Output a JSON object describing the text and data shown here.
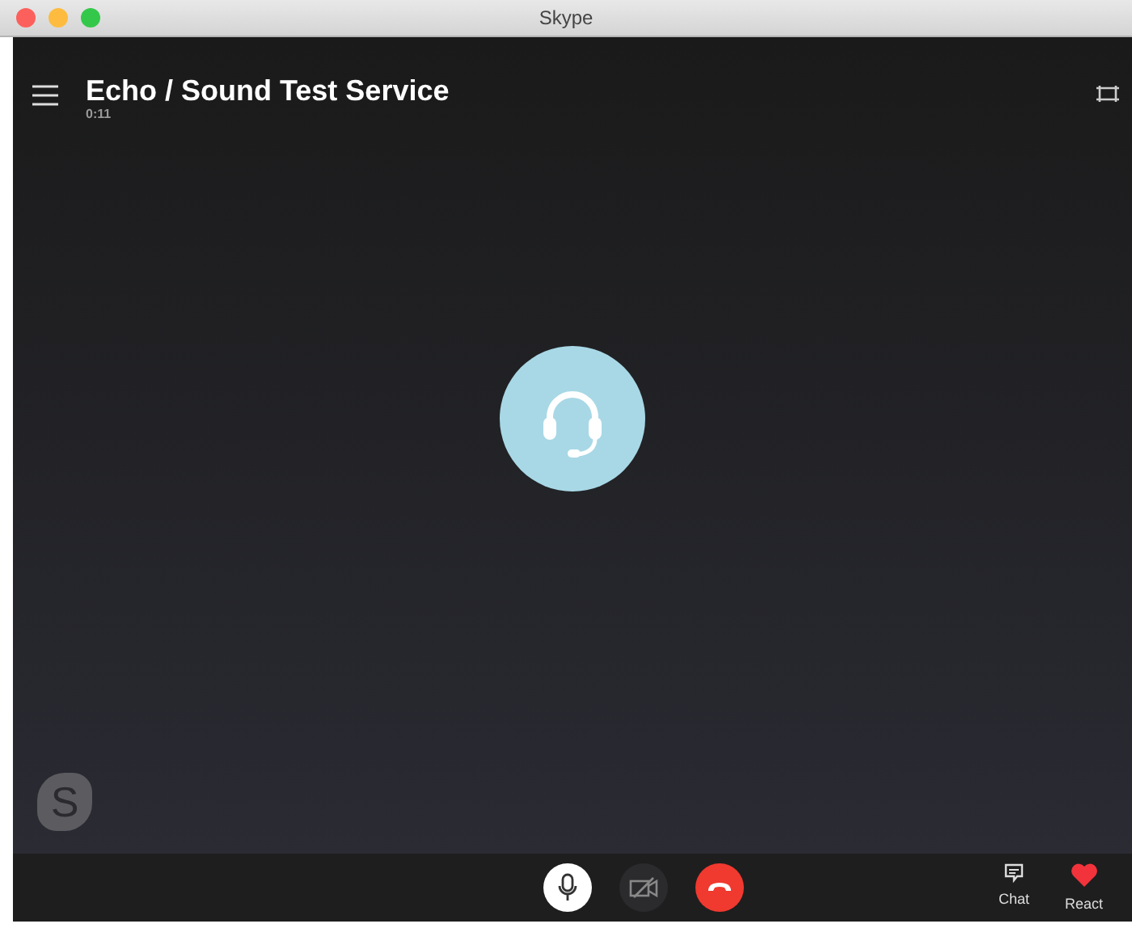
{
  "window": {
    "title": "Skype"
  },
  "call": {
    "title": "Echo / Sound Test Service",
    "duration": "0:11"
  },
  "logo": {
    "letter": "S"
  },
  "controls": [
    {
      "kind": "mic",
      "on": true
    },
    {
      "kind": "video",
      "on": false
    },
    {
      "kind": "hangup",
      "on": true
    }
  ],
  "actions": [
    {
      "kind": "chat",
      "label": "Chat"
    },
    {
      "kind": "react",
      "label": "React"
    }
  ]
}
